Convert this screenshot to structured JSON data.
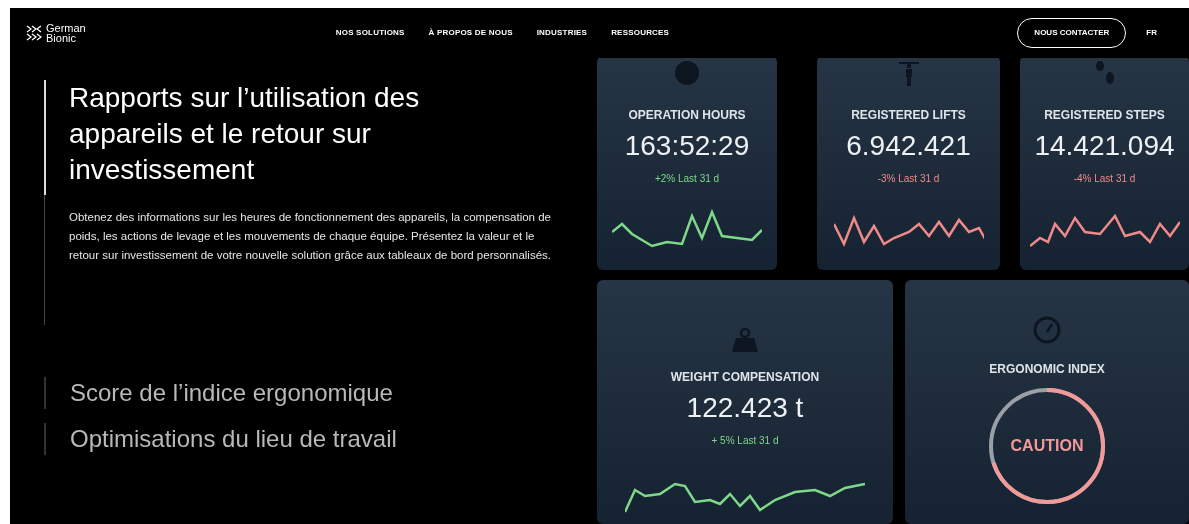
{
  "brand": {
    "line_1": "German",
    "line_2": "Bionic"
  },
  "nav": [
    "NOS SOLUTIONS",
    "À PROPOS DE NOUS",
    "INDUSTRIES",
    "RESSOURCES"
  ],
  "contact_button": "NOUS CONTACTER",
  "language": "FR",
  "sections": [
    {
      "title": "Rapports sur l’utilisation des appareils et le retour sur investissement",
      "selected": true,
      "description": "Obtenez des informations sur les heures de fonctionnement des appareils, la compensation de poids, les actions de levage et les mouvements de chaque équipe. Présentez la valeur et le retour sur investissement de votre nouvelle solution grâce aux tableaux de bord personnalisés."
    },
    {
      "title": "Score de l’indice ergonomique",
      "selected": false
    },
    {
      "title": "Optimisations du lieu de travail",
      "selected": false
    }
  ],
  "stats": [
    {
      "kind": "stat",
      "label": "OPERATION HOURS",
      "value": "163:52:29",
      "change": "+2% Last 31 d",
      "color": "#7fd88a"
    },
    {
      "kind": "stat",
      "label": "REGISTERED LIFTS",
      "value": "6.942.421",
      "change": "-3% Last 31 d",
      "color": "#f08a8a"
    },
    {
      "kind": "stat",
      "label": "REGISTERED STEPS",
      "value": "14.421.094",
      "change": "-4% Last 31 d",
      "color": "#f08a8a"
    },
    {
      "kind": "stat",
      "label": "WEIGHT COMPENSATION",
      "value": "122.423 t",
      "change": "+ 5% Last 31 d",
      "color": "#7fd88a"
    },
    {
      "kind": "gauge",
      "label": "ERGONOMIC INDEX",
      "status": "CAUTION"
    }
  ]
}
